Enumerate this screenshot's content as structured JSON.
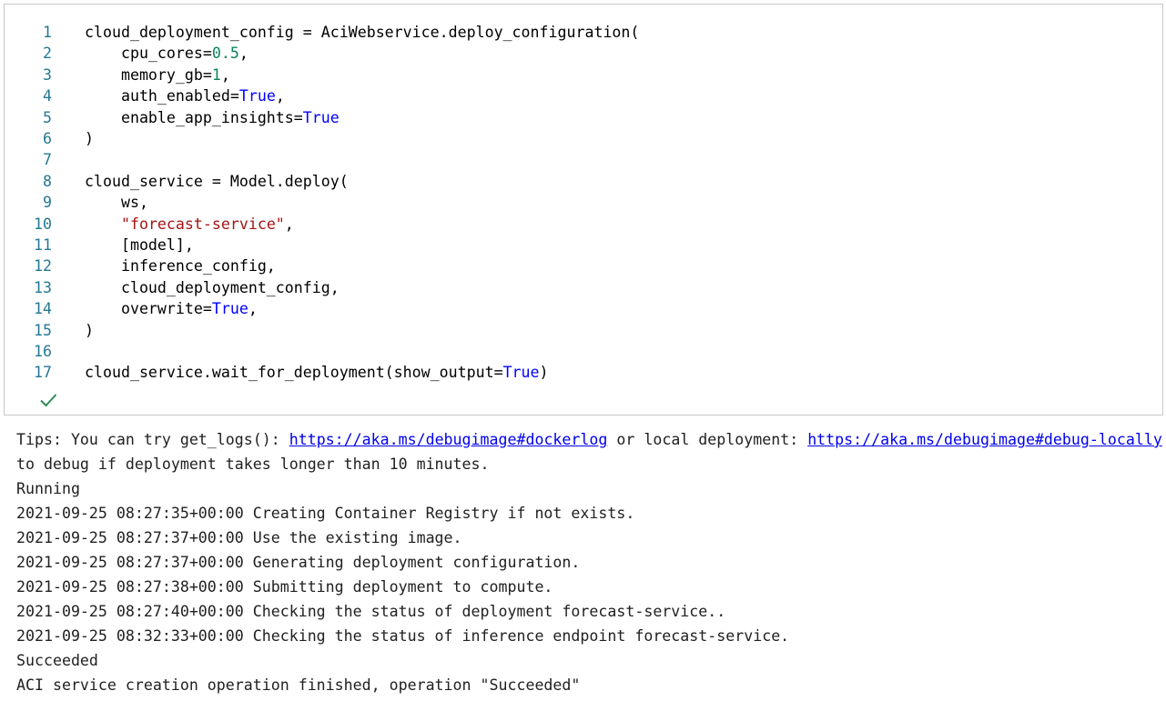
{
  "code_cell": {
    "lines": [
      {
        "num": "1",
        "parts": [
          {
            "t": "cloud_deployment_config = AciWebservice.deploy_configuration(",
            "c": ""
          }
        ]
      },
      {
        "num": "2",
        "parts": [
          {
            "t": "    cpu_cores=",
            "c": ""
          },
          {
            "t": "0.5",
            "c": "num"
          },
          {
            "t": ",",
            "c": ""
          }
        ]
      },
      {
        "num": "3",
        "parts": [
          {
            "t": "    memory_gb=",
            "c": ""
          },
          {
            "t": "1",
            "c": "num"
          },
          {
            "t": ",",
            "c": ""
          }
        ]
      },
      {
        "num": "4",
        "parts": [
          {
            "t": "    auth_enabled=",
            "c": ""
          },
          {
            "t": "True",
            "c": "kw"
          },
          {
            "t": ",",
            "c": ""
          }
        ]
      },
      {
        "num": "5",
        "parts": [
          {
            "t": "    enable_app_insights=",
            "c": ""
          },
          {
            "t": "True",
            "c": "kw"
          }
        ]
      },
      {
        "num": "6",
        "parts": [
          {
            "t": ")",
            "c": ""
          }
        ]
      },
      {
        "num": "7",
        "parts": []
      },
      {
        "num": "8",
        "parts": [
          {
            "t": "cloud_service = Model.deploy(",
            "c": ""
          }
        ]
      },
      {
        "num": "9",
        "parts": [
          {
            "t": "    ws,",
            "c": ""
          }
        ]
      },
      {
        "num": "10",
        "parts": [
          {
            "t": "    ",
            "c": ""
          },
          {
            "t": "\"forecast-service\"",
            "c": "str"
          },
          {
            "t": ",",
            "c": ""
          }
        ]
      },
      {
        "num": "11",
        "parts": [
          {
            "t": "    [model],",
            "c": ""
          }
        ]
      },
      {
        "num": "12",
        "parts": [
          {
            "t": "    inference_config,",
            "c": ""
          }
        ]
      },
      {
        "num": "13",
        "parts": [
          {
            "t": "    cloud_deployment_config,",
            "c": ""
          }
        ]
      },
      {
        "num": "14",
        "parts": [
          {
            "t": "    overwrite=",
            "c": ""
          },
          {
            "t": "True",
            "c": "kw"
          },
          {
            "t": ",",
            "c": ""
          }
        ]
      },
      {
        "num": "15",
        "parts": [
          {
            "t": ")",
            "c": ""
          }
        ]
      },
      {
        "num": "16",
        "parts": []
      },
      {
        "num": "17",
        "parts": [
          {
            "t": "cloud_service.wait_for_deployment(show_output=",
            "c": ""
          },
          {
            "t": "True",
            "c": "kw"
          },
          {
            "t": ")",
            "c": ""
          }
        ]
      }
    ],
    "status_icon": "checkmark-icon",
    "status_color": "#2e8b57"
  },
  "output": {
    "tips_prefix": "Tips: You can try get_logs(): ",
    "link_docker": "https://aka.ms/debugimage#dockerlog",
    "tips_middle": " or local deployment: ",
    "link_local": "https://aka.ms/debugimage#debug-locally",
    "tips_continuation": "to debug if deployment takes longer than 10 minutes.",
    "lines": [
      "Running",
      "2021-09-25 08:27:35+00:00 Creating Container Registry if not exists.",
      "2021-09-25 08:27:37+00:00 Use the existing image.",
      "2021-09-25 08:27:37+00:00 Generating deployment configuration.",
      "2021-09-25 08:27:38+00:00 Submitting deployment to compute.",
      "2021-09-25 08:27:40+00:00 Checking the status of deployment forecast-service..",
      "2021-09-25 08:32:33+00:00 Checking the status of inference endpoint forecast-service.",
      "Succeeded",
      "ACI service creation operation finished, operation \"Succeeded\""
    ]
  }
}
